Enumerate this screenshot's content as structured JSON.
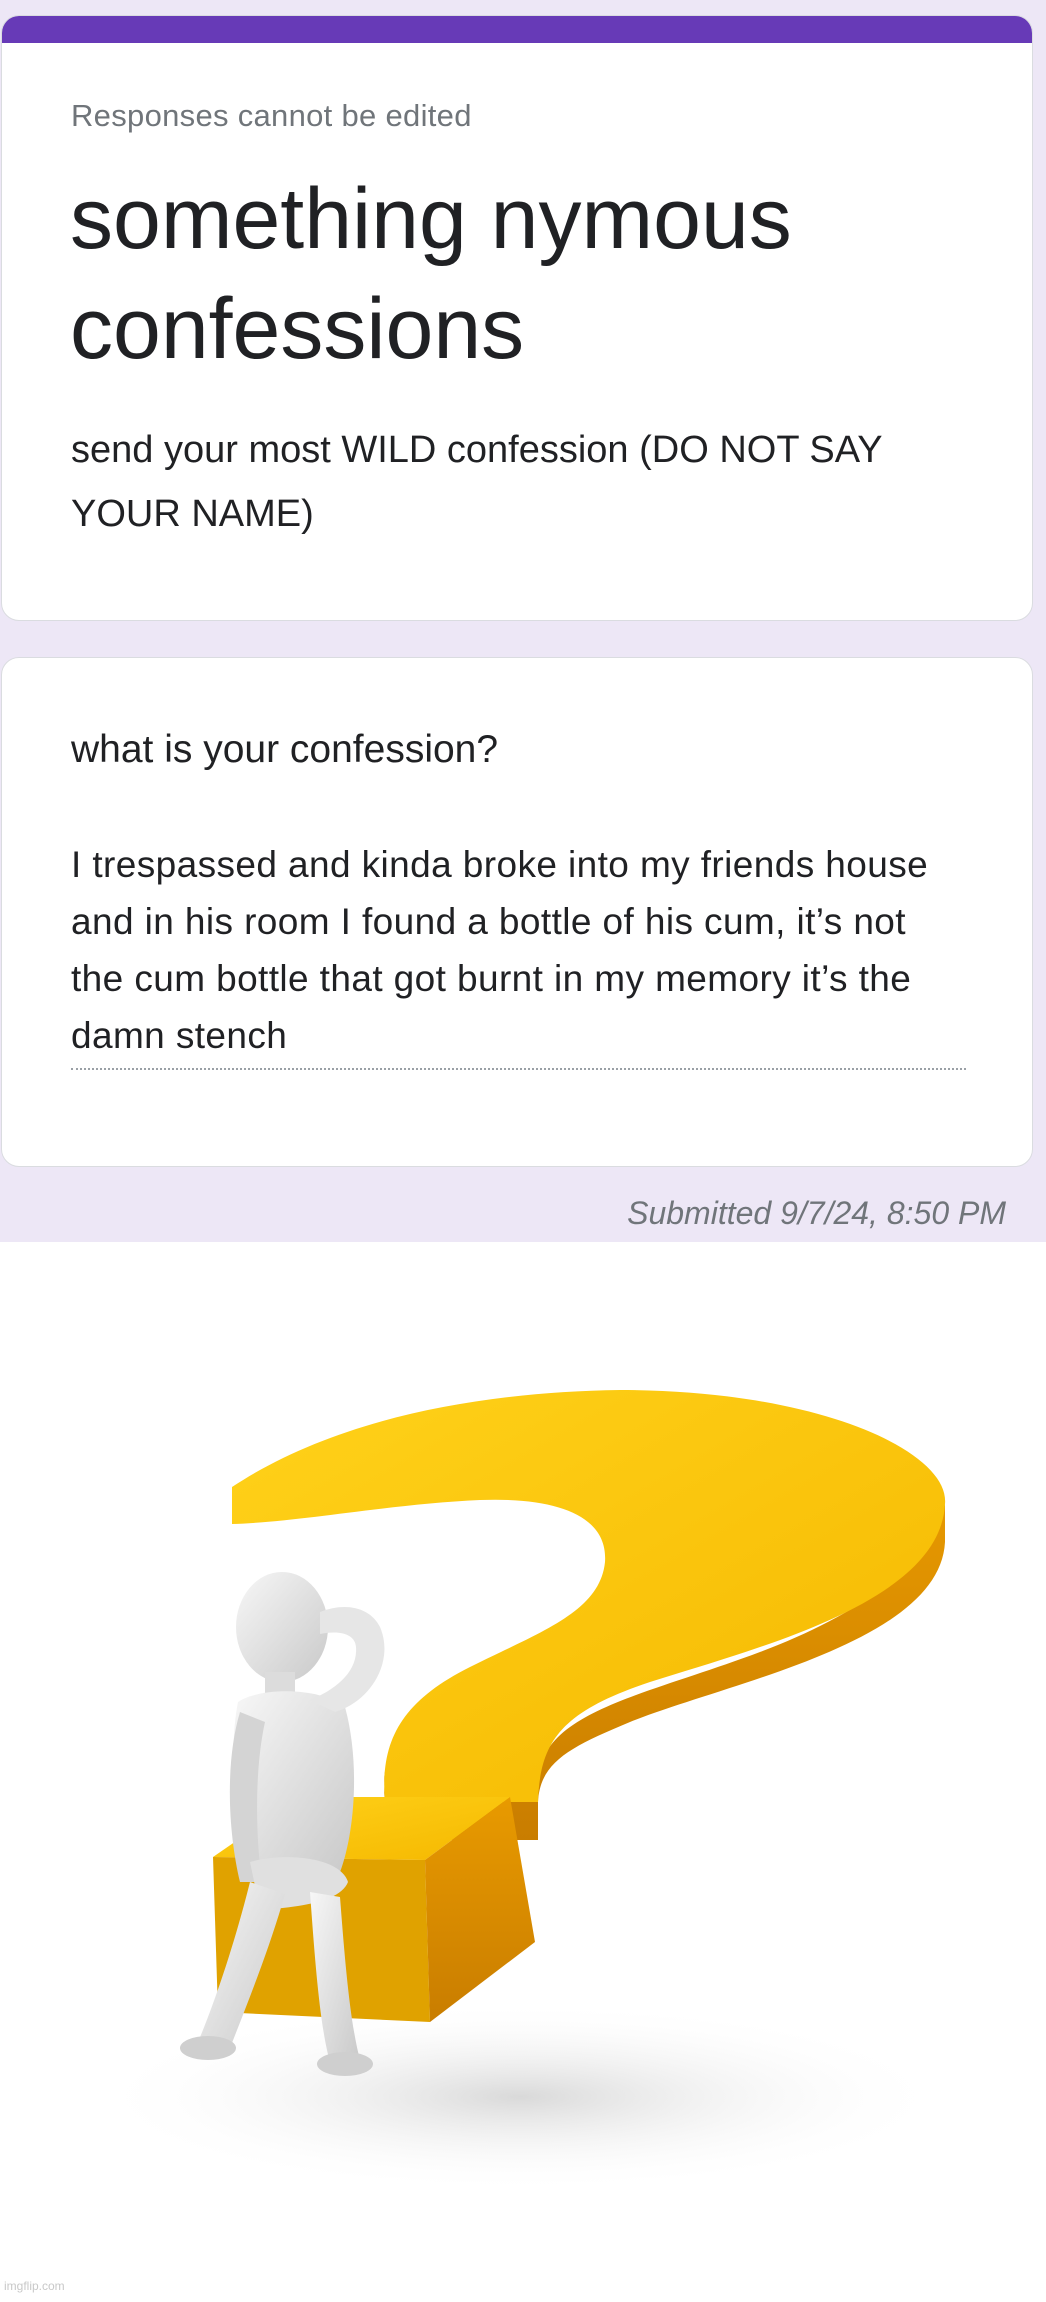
{
  "form": {
    "accent_color": "#673ab7",
    "background_color": "#ede7f6",
    "notice": "Responses cannot be edited",
    "title": "something nymous confessions",
    "description": "send your most WILD confession (DO NOT SAY YOUR NAME)"
  },
  "question": {
    "title": "what is your confession?",
    "answer": "I trespassed and kinda broke into my friends house and in his room I found a bottle of his cum, it’s not the cum bottle that got burnt in my memory it’s the damn stench"
  },
  "footer": {
    "submitted": "Submitted 9/7/24, 8:50 PM"
  },
  "image": {
    "description_icon": "question-mark-figure",
    "watermark": "imgflip.com"
  }
}
